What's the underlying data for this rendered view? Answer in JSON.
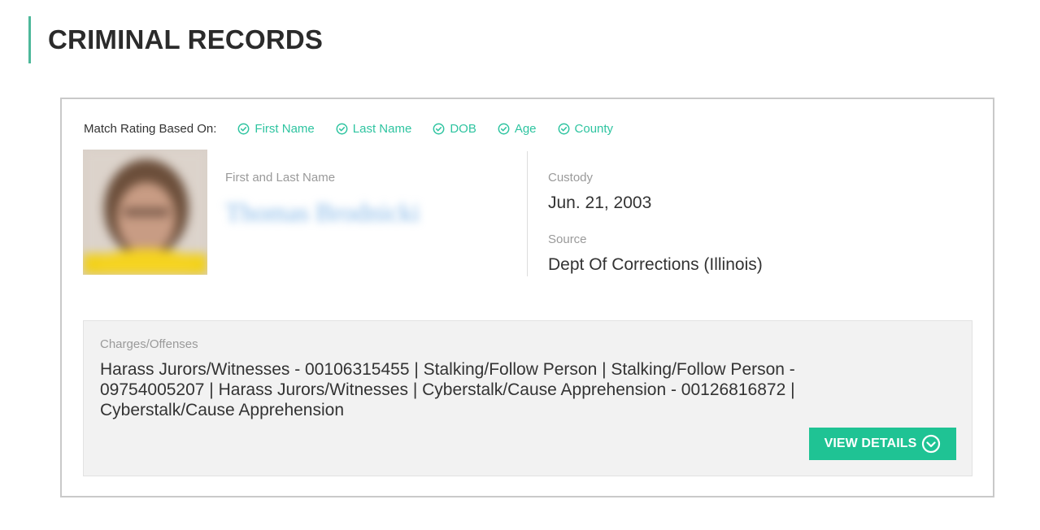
{
  "section": {
    "title": "CRIMINAL RECORDS"
  },
  "match": {
    "label": "Match Rating Based On:",
    "criteria": [
      {
        "label": "First Name",
        "icon": "check-circle-icon"
      },
      {
        "label": "Last Name",
        "icon": "check-circle-icon"
      },
      {
        "label": "DOB",
        "icon": "check-circle-icon"
      },
      {
        "label": "Age",
        "icon": "check-circle-icon"
      },
      {
        "label": "County",
        "icon": "check-circle-icon"
      }
    ]
  },
  "record": {
    "name_label": "First and Last Name",
    "name_value": "Thomas Brodnicki",
    "custody_label": "Custody",
    "custody_value": "Jun. 21, 2003",
    "source_label": "Source",
    "source_value": "Dept Of Corrections (Illinois)"
  },
  "charges": {
    "label": "Charges/Offenses",
    "text": "Harass Jurors/Witnesses - 00106315455  |  Stalking/Follow Person  |  Stalking/Follow Person - 09754005207  |  Harass Jurors/Witnesses  |  Cyberstalk/Cause Apprehension - 00126816872  |  Cyberstalk/Cause Apprehension"
  },
  "actions": {
    "view_details_label": "VIEW DETAILS",
    "view_details_icon": "chevron-down-circle-icon"
  },
  "colors": {
    "accent": "#1fc394",
    "match_green": "#2ec4a0",
    "header_bar": "#4db89a"
  }
}
